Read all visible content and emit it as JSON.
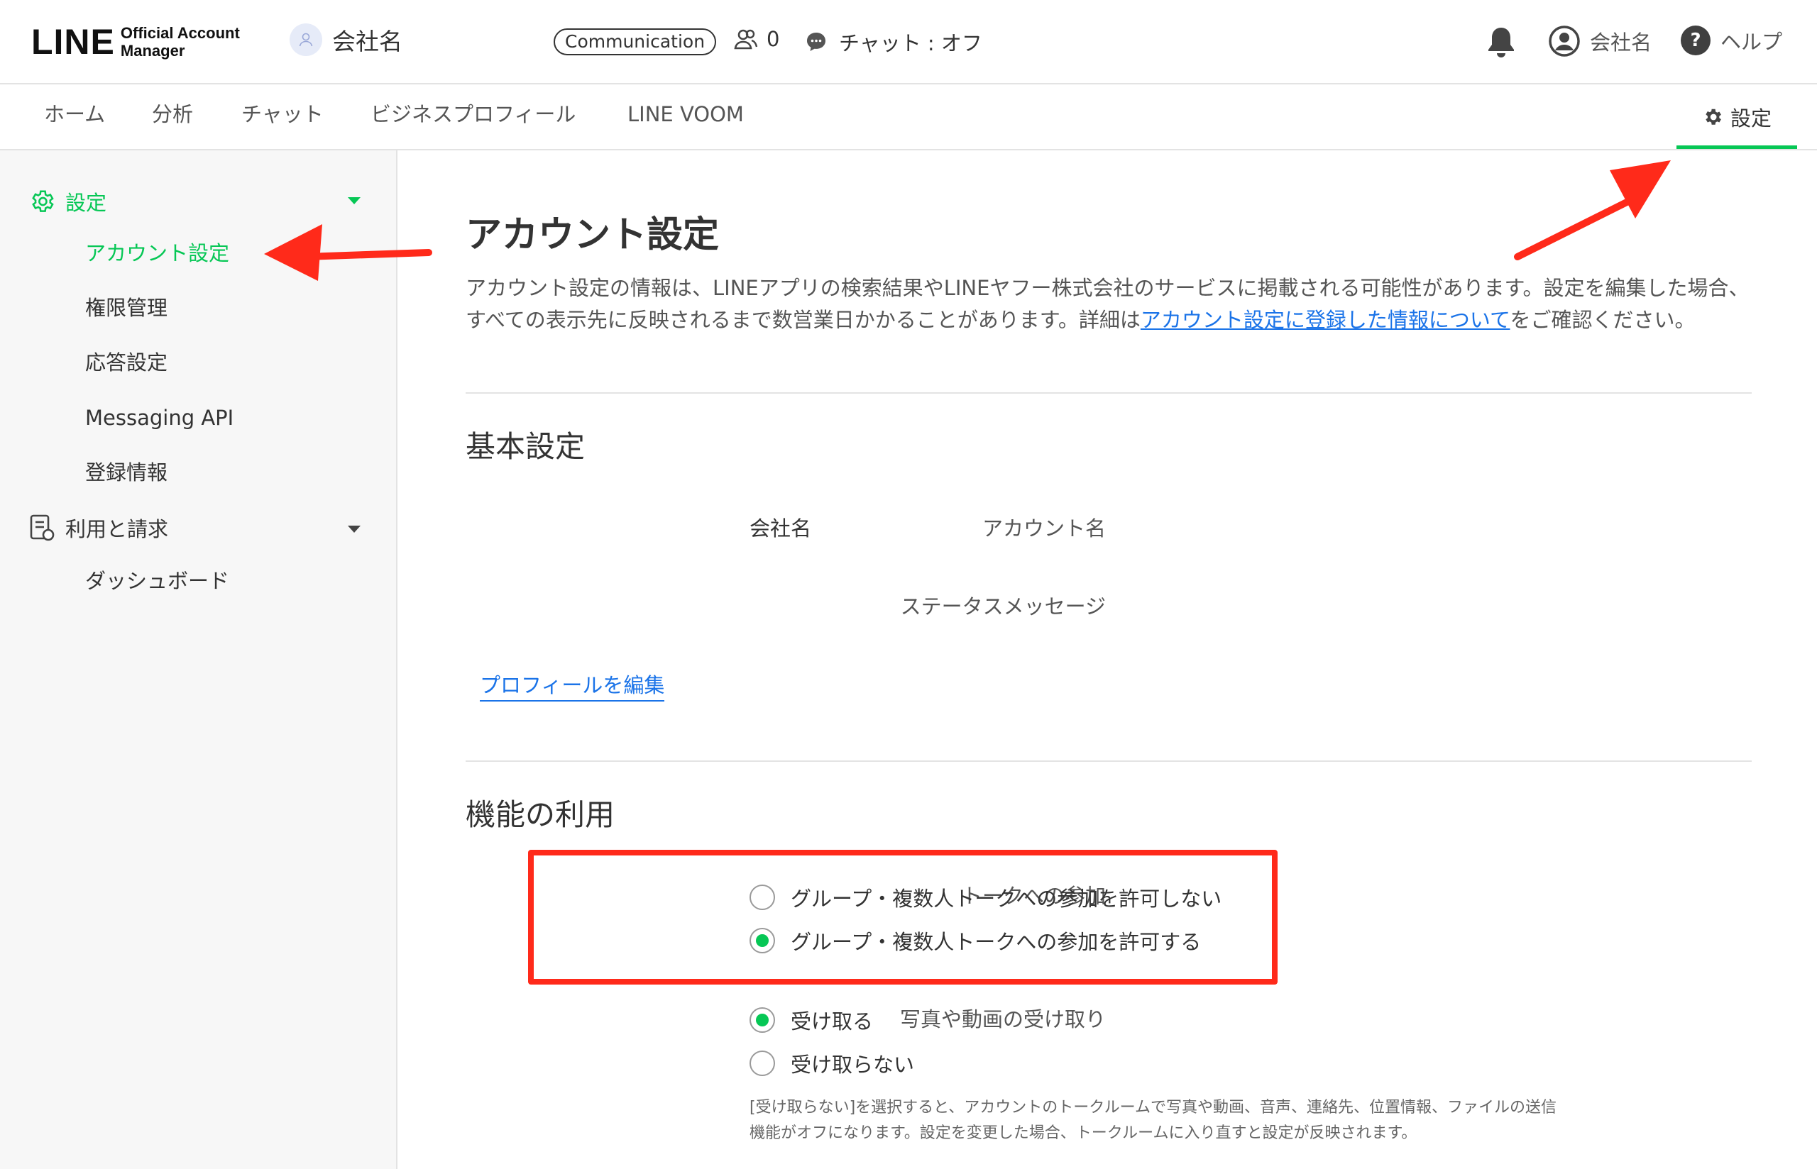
{
  "header": {
    "logo_main": "LINE",
    "logo_sub_line1": "Official Account",
    "logo_sub_line2": "Manager",
    "account_name": "会社名",
    "plan_badge": "Communication",
    "friend_count": "0",
    "chat_status": "チャット : オフ",
    "user_name": "会社名",
    "help_label": "ヘルプ",
    "help_icon_glyph": "?"
  },
  "nav": {
    "tabs": [
      {
        "label": "ホーム"
      },
      {
        "label": "分析"
      },
      {
        "label": "チャット"
      },
      {
        "label": "ビジネスプロフィール"
      },
      {
        "label": "LINE VOOM"
      }
    ],
    "settings_label": "設定"
  },
  "sidebar": {
    "groups": [
      {
        "label": "設定",
        "icon": "gear-icon",
        "items": [
          {
            "label": "アカウント設定",
            "active": true
          },
          {
            "label": "権限管理"
          },
          {
            "label": "応答設定"
          },
          {
            "label": "Messaging API"
          },
          {
            "label": "登録情報"
          }
        ]
      },
      {
        "label": "利用と請求",
        "icon": "billing-icon",
        "items": [
          {
            "label": "ダッシュボード"
          }
        ]
      }
    ]
  },
  "main": {
    "title": "アカウント設定",
    "description_part1": "アカウント設定の情報は、LINEアプリの検索結果やLINEヤフー株式会社のサービスに掲載される可能性があります。設定を編集した場合、すべての表示先に反映されるまで数営業日かかることがあります。詳細は",
    "description_link": "アカウント設定に登録した情報について",
    "description_part2": "をご確認ください。",
    "basic": {
      "title": "基本設定",
      "account_name_label": "アカウント名",
      "account_name_value": "会社名",
      "status_message_label": "ステータスメッセージ",
      "status_message_value": "",
      "edit_profile_link": "プロフィールを編集"
    },
    "features": {
      "title": "機能の利用",
      "talk_join": {
        "label": "トークへの参加",
        "options": [
          {
            "label": "グループ・複数人トークへの参加を許可しない",
            "checked": false
          },
          {
            "label": "グループ・複数人トークへの参加を許可する",
            "checked": true
          }
        ]
      },
      "media_receive": {
        "label": "写真や動画の受け取り",
        "options": [
          {
            "label": "受け取る",
            "checked": true
          },
          {
            "label": "受け取らない",
            "checked": false
          }
        ],
        "note": "[受け取らない]を選択すると、アカウントのトークルームで写真や動画、音声、連絡先、位置情報、ファイルの送信機能がオフになります。設定を変更した場合、トークルームに入り直すと設定が反映されます。"
      }
    }
  },
  "colors": {
    "accent_green": "#06c755",
    "link_blue": "#1a73e8",
    "annotation_red": "#ff2a1a"
  }
}
